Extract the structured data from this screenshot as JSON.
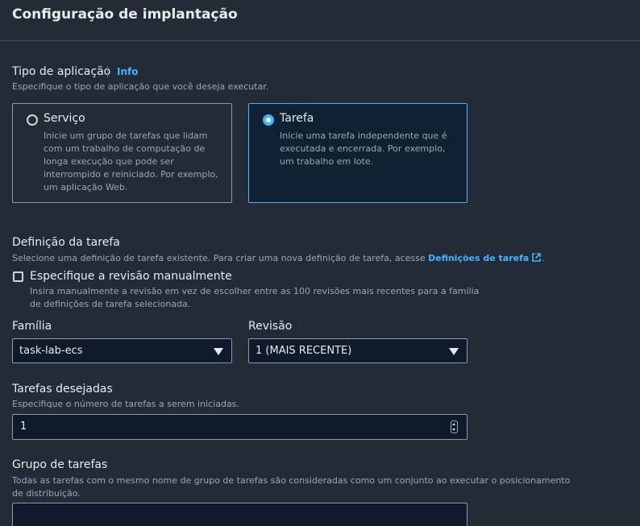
{
  "page": {
    "title": "Configuração de implantação"
  },
  "app_type": {
    "title": "Tipo de aplicação",
    "info": "Info",
    "description": "Especifique o tipo de aplicação que você deseja executar.",
    "options": [
      {
        "label": "Serviço",
        "description": "Inicie um grupo de tarefas que lidam com um trabalho de computação de longa execução que pode ser interrompido e reiniciado. Por exemplo, um aplicação Web.",
        "selected": false
      },
      {
        "label": "Tarefa",
        "description": "Inicie uma tarefa independente que é executada e encerrada. Por exemplo, um trabalho em lote.",
        "selected": true
      }
    ]
  },
  "task_definition": {
    "title": "Definição da tarefa",
    "description": "Selecione uma definição de tarefa existente. Para criar uma nova definição de tarefa, acesse",
    "link": "Definições de tarefa",
    "link_suffix": ".",
    "manual_checkbox": {
      "label": "Especifique a revisão manualmente",
      "description": "Insira manualmente a revisão em vez de escolher entre as 100 revisões mais recentes para a família de definições de tarefa selecionada.",
      "checked": false
    },
    "family": {
      "label": "Família",
      "value": "task-lab-ecs"
    },
    "revision": {
      "label": "Revisão",
      "value": "1 (MAIS RECENTE)"
    }
  },
  "desired_tasks": {
    "title": "Tarefas desejadas",
    "description": "Especifique o número de tarefas a serem iniciadas.",
    "value": "1"
  },
  "task_group": {
    "title": "Grupo de tarefas",
    "description": "Todas as tarefas com o mesmo nome de grupo de tarefas são consideradas como um conjunto ao executar o posicionamento de distribuição.",
    "value": ""
  },
  "colors": {
    "accent": "#42b4ff",
    "background": "#232b37",
    "input_bg": "#0f1b2a"
  }
}
